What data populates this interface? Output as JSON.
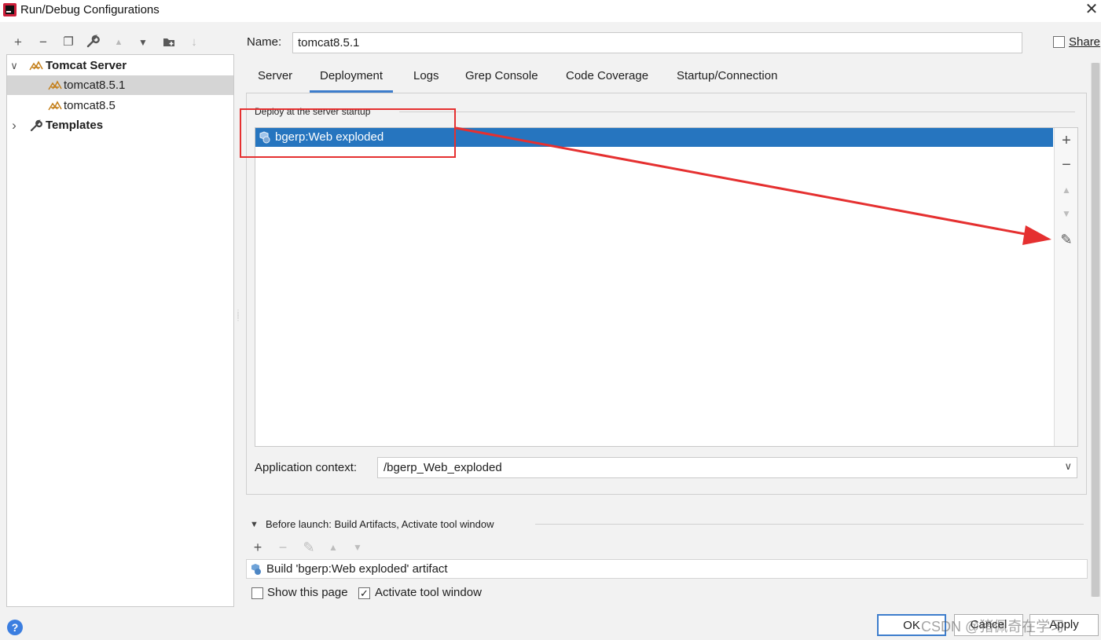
{
  "window": {
    "title": "Run/Debug Configurations",
    "close_glyph": "✕"
  },
  "toolbar": {
    "icons": [
      "add-icon",
      "remove-icon",
      "copy-icon",
      "edit-defaults-icon",
      "move-up-icon",
      "move-down-icon",
      "new-folder-icon",
      "sort-icon"
    ],
    "glyphs": {
      "add": "+",
      "remove": "−",
      "copy": "❐",
      "wrench": "🔧",
      "up": "▲",
      "down": "▼",
      "folder": "▤",
      "sort": "↓"
    }
  },
  "tree": {
    "group": {
      "label": "Tomcat Server",
      "expanded_glyph": "∨"
    },
    "items": [
      {
        "label": "tomcat8.5.1",
        "selected": true
      },
      {
        "label": "tomcat8.5",
        "selected": false
      }
    ],
    "templates": {
      "label": "Templates",
      "collapsed_glyph": "›"
    }
  },
  "form": {
    "name_label": "Name:",
    "name_value": "tomcat8.5.1",
    "share_label": "Share"
  },
  "tabs": [
    {
      "label": "Server",
      "active": false
    },
    {
      "label": "Deployment",
      "active": true
    },
    {
      "label": "Logs",
      "active": false
    },
    {
      "label": "Grep Console",
      "active": false
    },
    {
      "label": "Code Coverage",
      "active": false
    },
    {
      "label": "Startup/Connection",
      "active": false
    }
  ],
  "deployment": {
    "section_label": "Deploy at the server startup",
    "items": [
      {
        "label": "bgerp:Web exploded",
        "selected": true
      }
    ],
    "side_buttons": {
      "add": "+",
      "remove": "−",
      "up": "▲",
      "down": "▼",
      "edit": "✎"
    },
    "app_context_label": "Application context:",
    "app_context_value": "/bgerp_Web_exploded",
    "dropdown_glyph": "∨"
  },
  "before_launch": {
    "label": "Before launch: Build Artifacts, Activate tool window",
    "task": "Build 'bgerp:Web exploded' artifact",
    "buttons": {
      "add": "+",
      "remove": "−",
      "edit": "✎",
      "up": "▲",
      "down": "▼"
    }
  },
  "options": {
    "show_this_page": {
      "label": "Show this page",
      "checked": false
    },
    "activate_tool_window": {
      "label": "Activate tool window",
      "checked": true
    }
  },
  "footer": {
    "help": "?",
    "ok": "OK",
    "cancel": "Cancel",
    "apply": "Apply"
  },
  "watermark": "CSDN @猪佩奇在学习",
  "colors": {
    "selection": "#2675bf",
    "tab_underline": "#3d7dcc",
    "annotation": "#e53030",
    "help": "#3b7ee0"
  }
}
